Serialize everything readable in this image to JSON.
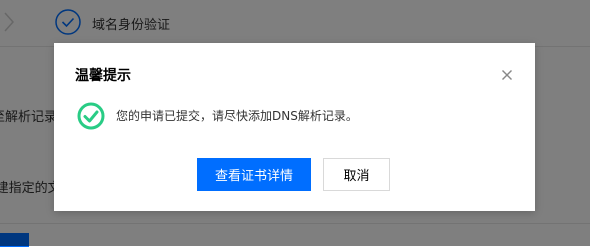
{
  "background": {
    "step_label": "域名身份验证",
    "partial_line_1": "至解析记录，",
    "partial_line_2": "l建指定的文"
  },
  "dialog": {
    "title": "温馨提示",
    "message": "您的申请已提交，请尽快添加DNS解析记录。",
    "primary_button": "查看证书详情",
    "secondary_button": "取消"
  },
  "colors": {
    "primary": "#006eff",
    "success": "#29cc85"
  }
}
